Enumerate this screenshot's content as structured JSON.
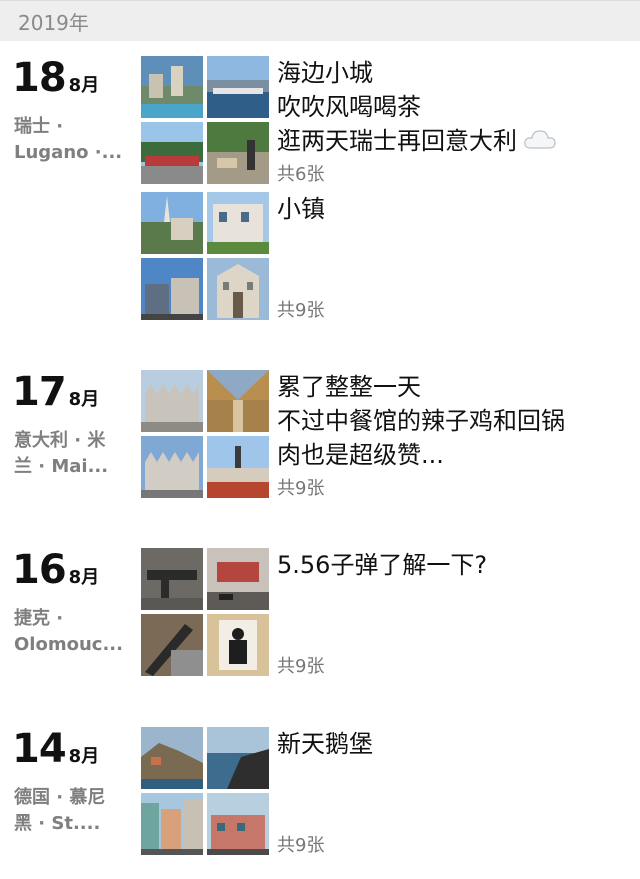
{
  "header": {
    "year": "2019年"
  },
  "entries": [
    {
      "day": "18",
      "month": "8月",
      "location": [
        "瑞士 ·",
        "Lugano ·..."
      ],
      "posts": [
        {
          "lines": [
            "海边小城",
            "吹吹风喝喝茶",
            "逛两天瑞士再回意大利"
          ],
          "count": "共6张"
        },
        {
          "lines": [
            "小镇"
          ],
          "count": "共9张"
        }
      ]
    },
    {
      "day": "17",
      "month": "8月",
      "location": [
        "意大利 · 米",
        "兰 · Mai..."
      ],
      "posts": [
        {
          "lines": [
            "累了整整一天",
            "不过中餐馆的辣子鸡和回锅",
            "肉也是超级赞..."
          ],
          "count": "共9张"
        }
      ]
    },
    {
      "day": "16",
      "month": "8月",
      "location": [
        "捷克 ·",
        "Olomouc..."
      ],
      "posts": [
        {
          "lines": [
            "5.56子弹了解一下?"
          ],
          "count": "共9张"
        }
      ]
    },
    {
      "day": "14",
      "month": "8月",
      "location": [
        "德国 · 慕尼",
        "黑 · St...."
      ],
      "posts": [
        {
          "lines": [
            "新天鹅堡"
          ],
          "count": "共9张"
        }
      ]
    }
  ],
  "icons": {
    "weather": "cloud-icon"
  }
}
